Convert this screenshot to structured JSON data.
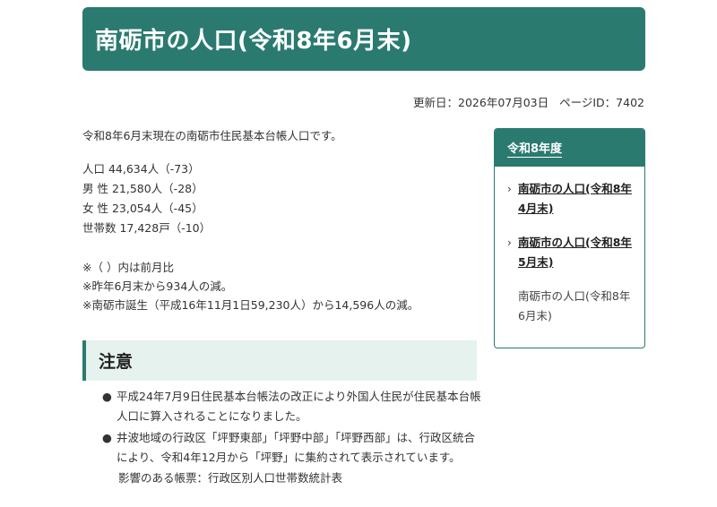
{
  "header": {
    "title": "南砺市の人口(令和8年6月末)"
  },
  "meta": {
    "updated": "更新日：2026年07月03日",
    "page_id": "ページID：7402"
  },
  "main": {
    "intro": "令和8年6月末現在の南砺市住民基本台帳人口です。",
    "stats": [
      "人口 44,634人（-73）",
      "男 性 21,580人（-28）",
      "女 性 23,054人（-45）",
      "世帯数 17,428戸（-10）"
    ],
    "notes": [
      "※（ ）内は前月比",
      "※昨年6月末から934人の減。",
      "※南砺市誕生（平成16年11月1日59,230人）から14,596人の減。"
    ]
  },
  "notice": {
    "heading": "注意",
    "items": [
      "平成24年7月9日住民基本台帳法の改正により外国人住民が住民基本台帳人口に算入されることになりました。",
      "井波地域の行政区「坪野東部」「坪野中部」「坪野西部」は、行政区統合により、令和4年12月から「坪野」に集約されて表示されています。"
    ],
    "impact": "影響のある帳票：行政区別人口世帯数統計表"
  },
  "sidebar": {
    "header": "令和8年度",
    "items": [
      {
        "label": "南砺市の人口(令和8年4月末)",
        "current": false
      },
      {
        "label": "南砺市の人口(令和8年5月末)",
        "current": false
      },
      {
        "label": "南砺市の人口(令和8年6月末)",
        "current": true
      }
    ]
  },
  "colors": {
    "accent": "#2a7a70",
    "accent_light": "#e6f2ee"
  }
}
